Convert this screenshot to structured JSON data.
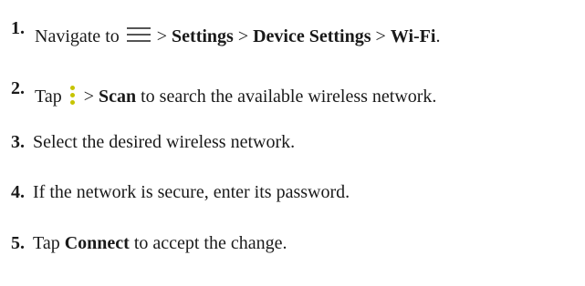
{
  "steps": [
    {
      "number": "1.",
      "text_before": "Navigate to",
      "icon": "menu-icon",
      "sep1": " > ",
      "bold1": "Settings",
      "sep2": " > ",
      "bold2": "Device Settings",
      "sep3": " > ",
      "bold3": "Wi-Fi",
      "text_after": "."
    },
    {
      "number": "2.",
      "text_before": "Tap",
      "icon": "overflow-menu-icon",
      "sep1": "> ",
      "bold1": "Scan",
      "text_after": " to search the available wireless network."
    },
    {
      "number": "3.",
      "text": "Select the desired wireless network."
    },
    {
      "number": "4.",
      "text": "If the network is secure, enter its password."
    },
    {
      "number": "5.",
      "text_before": "Tap ",
      "bold1": "Connect",
      "text_after": " to accept the change."
    }
  ],
  "colors": {
    "text": "#1a1a1a",
    "menu_icon": "#555555",
    "overflow_icon": "#c6c400"
  }
}
